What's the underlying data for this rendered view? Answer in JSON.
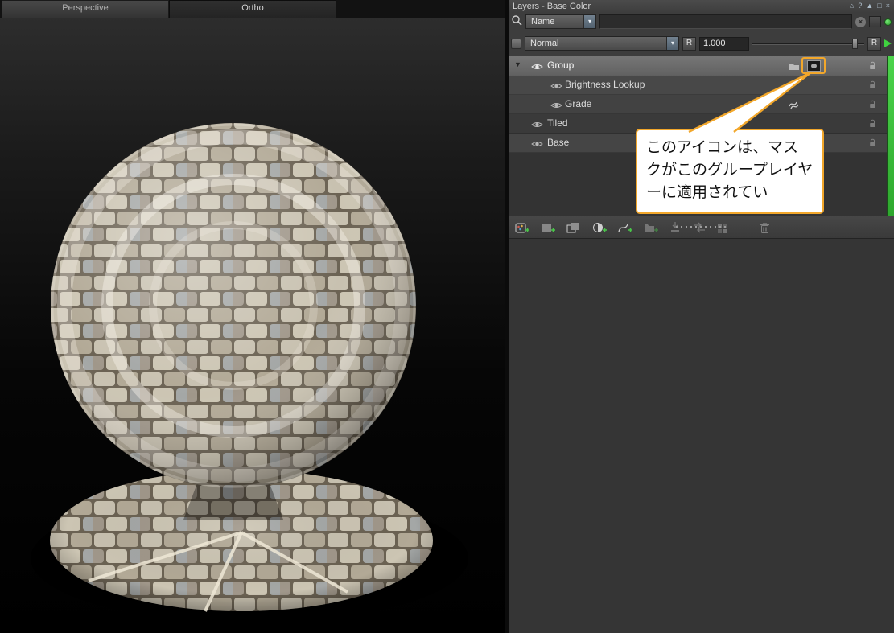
{
  "icons": {
    "expander": "▼",
    "dropdown_arrow": "▾",
    "clear": "×",
    "home": "⌂",
    "help": "?",
    "shade": "▲",
    "float": "□",
    "close": "×"
  },
  "viewport": {
    "tabs": [
      {
        "label": "Perspective"
      },
      {
        "label": "Ortho"
      }
    ],
    "active_tab": "Ortho"
  },
  "panel": {
    "title": "Layers - Base Color",
    "search": {
      "field": "Name",
      "value": ""
    },
    "blend": {
      "mode": "Normal",
      "reset_label": "R",
      "amount": "1.000",
      "reset_label_2": "R"
    },
    "layers": [
      {
        "name": "Group",
        "selected": true,
        "has_mask": true
      },
      {
        "name": "Brightness Lookup"
      },
      {
        "name": "Grade"
      },
      {
        "name": "Tiled"
      },
      {
        "name": "Base"
      }
    ],
    "callout": {
      "text": "このアイコンは、マスクがこのグループレイヤーに適用されてい"
    },
    "colors": {
      "highlight_orange": "#f2a72b",
      "cache_green": "#3fd23f"
    },
    "toolbar_icons": [
      "add-paint-layer",
      "add-layer",
      "duplicate-layer",
      "add-adjustment-layer",
      "add-graph-layer",
      "add-group-layer",
      "merge-layers",
      "transfer-layers",
      "add-channel-layer",
      "remove-layer"
    ]
  }
}
